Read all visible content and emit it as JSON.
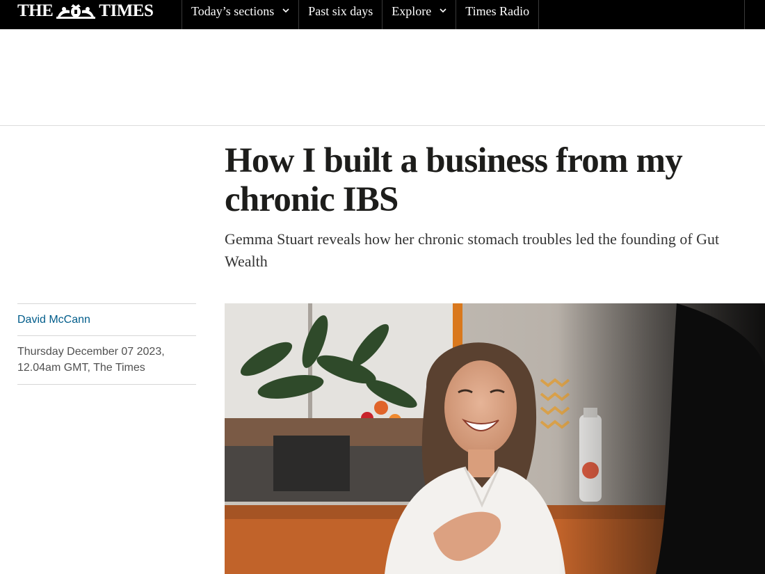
{
  "header": {
    "logo": {
      "left_text": "THE",
      "right_text": "TIMES",
      "crest_icon": "royal-crest-icon"
    },
    "nav": [
      {
        "label": "Today’s sections",
        "has_dropdown": true
      },
      {
        "label": "Past six days",
        "has_dropdown": false
      },
      {
        "label": "Explore",
        "has_dropdown": true
      },
      {
        "label": "Times Radio",
        "has_dropdown": false
      }
    ]
  },
  "article": {
    "headline_line1": "How I built a business from my",
    "headline_line2": "chronic IBS",
    "standfirst_line1": "Gemma Stuart reveals how her chronic stomach troubles led the founding of Gut",
    "standfirst_line2": "Wealth",
    "author": "David McCann",
    "date_line1": "Thursday December 07 2023,",
    "date_line2": "12.04am GMT, The Times"
  },
  "colors": {
    "nav_background": "#000000",
    "byline_link": "#005c8a",
    "headline_text": "#1d1d1b"
  }
}
